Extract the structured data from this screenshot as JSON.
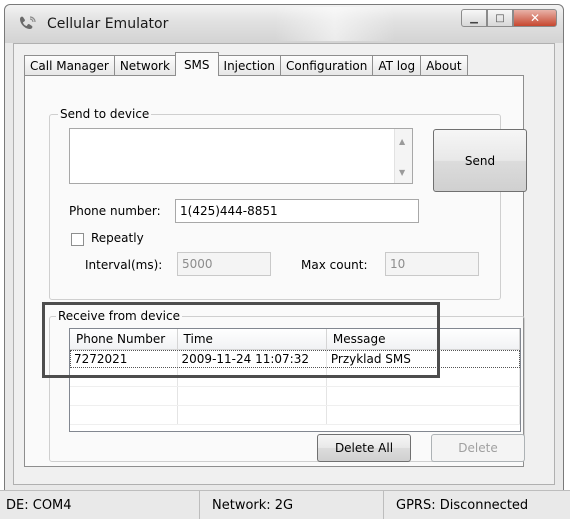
{
  "window": {
    "title": "Cellular Emulator",
    "icon": "phone-icon",
    "controls": {
      "minimize": "minimize-icon",
      "maximize": "maximize-icon",
      "close": "close-icon"
    }
  },
  "tabs": [
    {
      "label": "Call Manager"
    },
    {
      "label": "Network"
    },
    {
      "label": "SMS",
      "active": true
    },
    {
      "label": "Injection"
    },
    {
      "label": "Configuration"
    },
    {
      "label": "AT log"
    },
    {
      "label": "About"
    }
  ],
  "send_group": {
    "title": "Send to device",
    "message_value": "",
    "send_label": "Send",
    "phone_label": "Phone number:",
    "phone_value": "1(425)444-8851",
    "repeat_label": "Repeatly",
    "repeat_checked": false,
    "interval_label": "Interval(ms):",
    "interval_value": "5000",
    "maxcount_label": "Max count:",
    "maxcount_value": "10"
  },
  "receive_group": {
    "title": "Receive from device",
    "columns": [
      "Phone Number",
      "Time",
      "Message"
    ],
    "rows": [
      {
        "phone": "7272021",
        "time": "2009-11-24 11:07:32",
        "message": "Przyklad SMS"
      }
    ],
    "delete_all_label": "Delete All",
    "delete_label": "Delete"
  },
  "status": {
    "de": "DE: COM4",
    "network": "Network: 2G",
    "gprs": "GPRS: Disconnected"
  },
  "colors": {
    "highlight_border": "#4d4d4d",
    "close_button": "#c7472f"
  }
}
